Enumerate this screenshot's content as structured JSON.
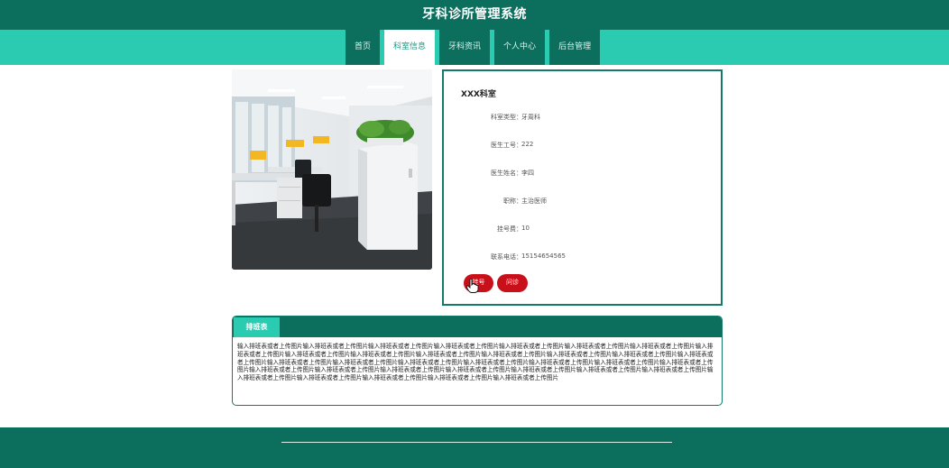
{
  "header": {
    "title": "牙科诊所管理系统"
  },
  "nav": {
    "items": [
      {
        "label": "首页"
      },
      {
        "label": "科室信息"
      },
      {
        "label": "牙科资讯"
      },
      {
        "label": "个人中心"
      },
      {
        "label": "后台管理"
      }
    ],
    "active_index": 1
  },
  "department": {
    "name": "XXX科室",
    "fields": [
      {
        "label": "科室类型：",
        "value": "牙周科"
      },
      {
        "label": "医生工号：",
        "value": "222"
      },
      {
        "label": "医生姓名：",
        "value": "李四"
      },
      {
        "label": "职称：",
        "value": "主治医师"
      },
      {
        "label": "挂号费：",
        "value": "10"
      },
      {
        "label": "联系电话：",
        "value": "15154654565"
      }
    ],
    "register_label": "挂号",
    "consult_label": "问诊"
  },
  "schedule": {
    "tab_label": "排班表",
    "content": "输入排班表或者上传图片输入排班表或者上传图片输入排班表或者上传图片输入排班表或者上传图片输入排班表或者上传图片输入排班表或者上传图片输入排班表或者上传图片输入排班表或者上传图片输入排班表或者上传图片输入排班表或者上传图片输入排班表或者上传图片输入排班表或者上传图片输入排班表或者上传图片输入排班表或者上传图片输入排班表或者上传图片输入排班表或者上传图片输入排班表或者上传图片输入排班表或者上传图片输入排班表或者上传图片输入排班表或者上传图片输入排班表或者上传图片输入排班表或者上传图片输入排班表或者上传图片输入排班表或者上传图片输入排班表或者上传图片输入排班表或者上传图片输入排班表或者上传图片输入排班表或者上传图片输入排班表或者上传图片输入排班表或者上传图片输入排班表或者上传图片输入排班表或者上传图片输入排班表或者上传图片输入排班表或者上传图片"
  },
  "colors": {
    "primary": "#0c6e5d",
    "accent": "#2bcbb1",
    "button": "#c8101b"
  }
}
